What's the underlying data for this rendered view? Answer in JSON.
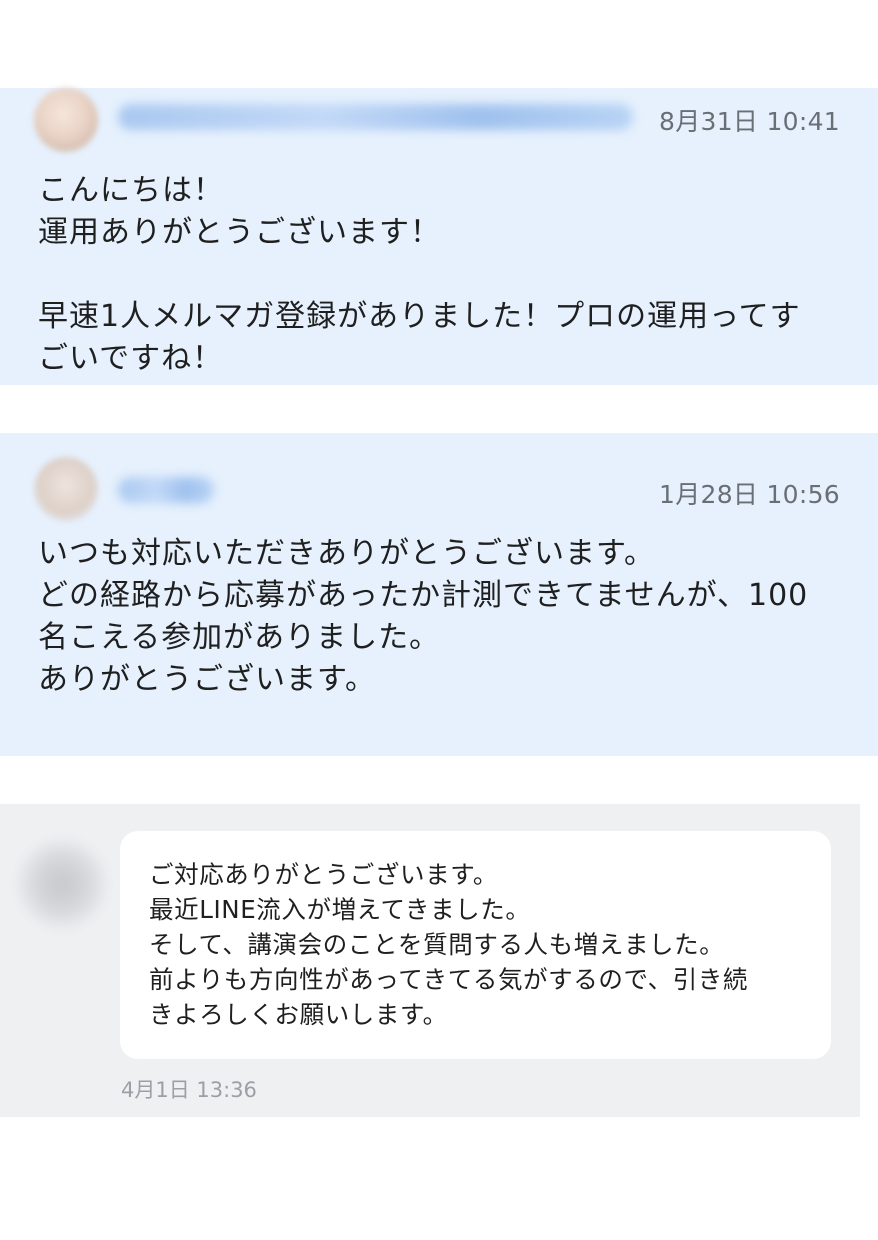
{
  "messages": [
    {
      "timestamp": "8月31日 10:41",
      "lines": [
        "こんにちは！",
        "運用ありがとうございます！",
        "",
        "早速1人メルマガ登録がありました！プロの運用ってす",
        "ごいですね！"
      ]
    },
    {
      "timestamp": "1月28日 10:56",
      "lines": [
        "いつも対応いただきありがとうございます。",
        "どの経路から応募があったか計測できてませんが、100",
        "名こえる参加がありました。",
        "ありがとうございます。"
      ]
    }
  ],
  "chat": {
    "timestamp": "4月1日 13:36",
    "lines": [
      "ご対応ありがとうございます。",
      "最近LINE流入が増えてきました。",
      "そして、講演会のことを質問する人も増えました。",
      "前よりも方向性があってきてる気がするので、引き続",
      "きよろしくお願いします。"
    ]
  }
}
